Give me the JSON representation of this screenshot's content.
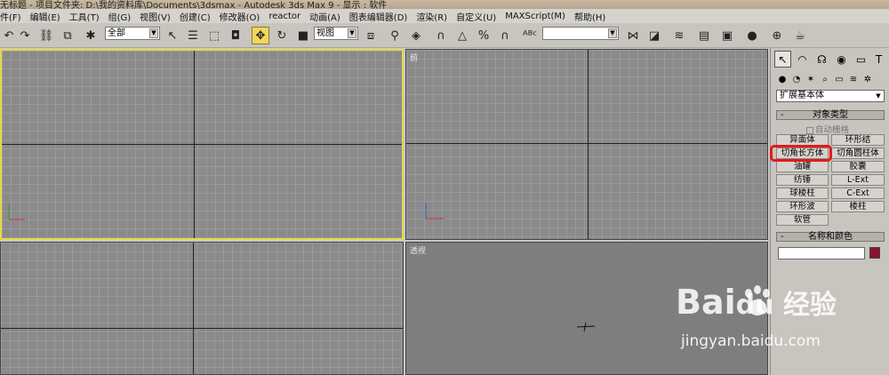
{
  "window": {
    "title": "无标题    - 项目文件夹: D:\\我的资料库\\Documents\\3dsmax    - Autodesk 3ds Max 9    - 显示 : 软件"
  },
  "menubar": {
    "items": [
      "件(F)",
      "编辑(E)",
      "工具(T)",
      "组(G)",
      "视图(V)",
      "创建(C)",
      "修改器(O)",
      "reactor",
      "动画(A)",
      "图表编辑器(D)",
      "渲染(R)",
      "自定义(U)",
      "MAXScript(M)",
      "帮助(H)"
    ]
  },
  "toolbar": {
    "selection_filter": "全部",
    "reference_coord": "视图",
    "named_selection": ""
  },
  "viewports": {
    "top_label": "",
    "front_label": "前",
    "left_label": "",
    "perspective_label": "透视"
  },
  "command_panel": {
    "category_value": "扩展基本体",
    "object_type_title": "对象类型",
    "auto_grid_label": "自动栅格",
    "buttons": [
      "异面体",
      "环形结",
      "切角长方体",
      "切角圆柱体",
      "油罐",
      "胶囊",
      "纺锤",
      "L-Ext",
      "球棱柱",
      "C-Ext",
      "环形波",
      "棱柱",
      "软管"
    ],
    "name_color_title": "名称和颜色",
    "rollout_minus": "-",
    "name_value": "",
    "object_color": "#8c1230"
  },
  "watermark": {
    "logo_text": "Bai",
    "logo_suffix": "du 经验",
    "url": "jingyan.baidu.com"
  }
}
